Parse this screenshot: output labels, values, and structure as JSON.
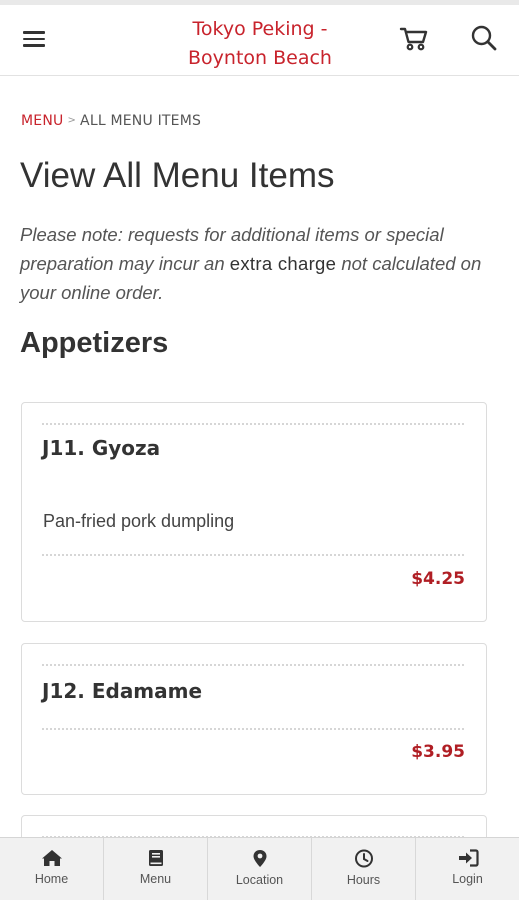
{
  "header": {
    "title_line1": "Tokyo Peking -",
    "title_line2": "Boynton Beach",
    "menu_icon": "hamburger-icon",
    "cart_icon": "cart-icon",
    "search_icon": "search-icon"
  },
  "breadcrumb": {
    "link": "MENU",
    "separator": ">",
    "current": "ALL MENU ITEMS"
  },
  "page_title": "View All Menu Items",
  "note": {
    "part1": "Please note: requests for additional items or special preparation may incur an ",
    "emphasis": "extra charge",
    "part2": " not calculated on your online order."
  },
  "section": {
    "title": "Appetizers"
  },
  "items": [
    {
      "name": "J11. Gyoza",
      "description": "Pan-fried pork dumpling",
      "price": "$4.25"
    },
    {
      "name": "J12. Edamame",
      "description": "",
      "price": "$3.95"
    }
  ],
  "bottom_nav": [
    {
      "label": "Home",
      "icon": "home-icon"
    },
    {
      "label": "Menu",
      "icon": "book-icon"
    },
    {
      "label": "Location",
      "icon": "map-pin-icon"
    },
    {
      "label": "Hours",
      "icon": "clock-icon"
    },
    {
      "label": "Login",
      "icon": "sign-in-icon"
    }
  ],
  "colors": {
    "brand_red": "#c8232c",
    "price_red": "#b01e24",
    "text": "#333333",
    "nav_bg": "#f1f1f1"
  }
}
